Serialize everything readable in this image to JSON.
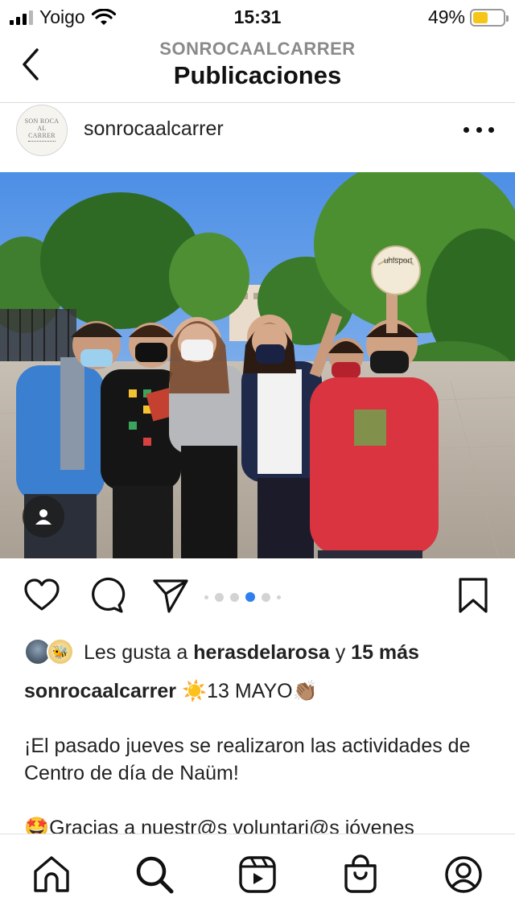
{
  "status_bar": {
    "carrier": "Yoigo",
    "time": "15:31",
    "battery_percent": "49%",
    "battery_level": 0.49,
    "battery_color": "#f5c518"
  },
  "header": {
    "subtitle": "SONROCAALCARRER",
    "title": "Publicaciones",
    "back_icon": "chevron-left-icon"
  },
  "post": {
    "avatar_lines": [
      "SON ROCA",
      "AL",
      "CARRER"
    ],
    "username": "sonrocaalcarrer",
    "more_icon": "more-horizontal-icon",
    "photo_ball_label": "uhlsport",
    "tag_icon": "person-tag-icon",
    "carousel": {
      "count": 6,
      "active_index": 4
    }
  },
  "actions": {
    "like_icon": "heart-icon",
    "comment_icon": "comment-icon",
    "share_icon": "send-icon",
    "save_icon": "bookmark-icon"
  },
  "likes": {
    "prefix": "Les gusta a",
    "user": "heras­delarosa",
    "connector": "y",
    "others": "15 más"
  },
  "caption": {
    "user": "sonrocaalcarrer",
    "line1_text": "13 MAYO",
    "sun_emoji": "☀️",
    "clap_emoji": "👏🏽",
    "paragraph1": "¡El pasado jueves se realizaron las actividades de Centro de día de Naüm!",
    "paragraph2_emoji": "🤩",
    "paragraph2": "Gracias a nuestr@s voluntari@s jóvenes"
  },
  "bottom_nav": {
    "items": [
      "home-icon",
      "search-icon",
      "reels-icon",
      "shop-icon",
      "profile-icon"
    ]
  },
  "colors": {
    "accent_dot": "#2f80ed",
    "divider": "#dcdcdc"
  }
}
